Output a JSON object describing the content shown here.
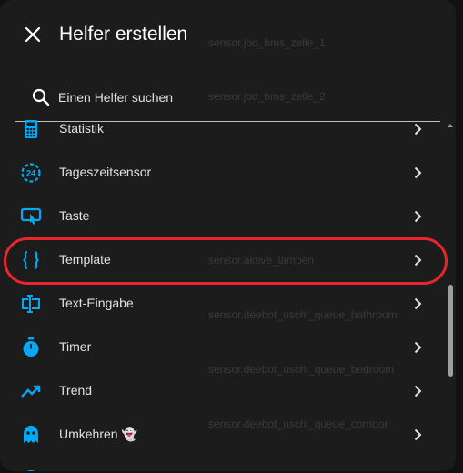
{
  "dialog": {
    "title": "Helfer erstellen",
    "close_icon": "close-icon",
    "accent_color": "#03a9f4"
  },
  "search": {
    "placeholder": "Einen Helfer suchen",
    "value": ""
  },
  "background_entities": [
    "sensor.jbd_bms_zelle_1",
    "sensor.jbd_bms_zelle_2",
    "sensor.aktive_lampen",
    "sensor.deebot_uschi_queue_bathroom",
    "sensor.deebot_uschi_queue_bedroom",
    "sensor.deebot_uschi_queue_corridor"
  ],
  "items": [
    {
      "label": "Statistik",
      "icon": "calculator-icon"
    },
    {
      "label": "Tageszeitsensor",
      "icon": "clock-24-icon"
    },
    {
      "label": "Taste",
      "icon": "gesture-tap-button-icon"
    },
    {
      "label": "Template",
      "icon": "code-braces-icon",
      "highlighted": true
    },
    {
      "label": "Text-Eingabe",
      "icon": "form-textbox-icon"
    },
    {
      "label": "Timer",
      "icon": "timer-icon"
    },
    {
      "label": "Trend",
      "icon": "trending-up-icon"
    },
    {
      "label": "Umkehren 👻",
      "icon": "ghost-icon"
    }
  ],
  "highlight_color": "#e8262d"
}
